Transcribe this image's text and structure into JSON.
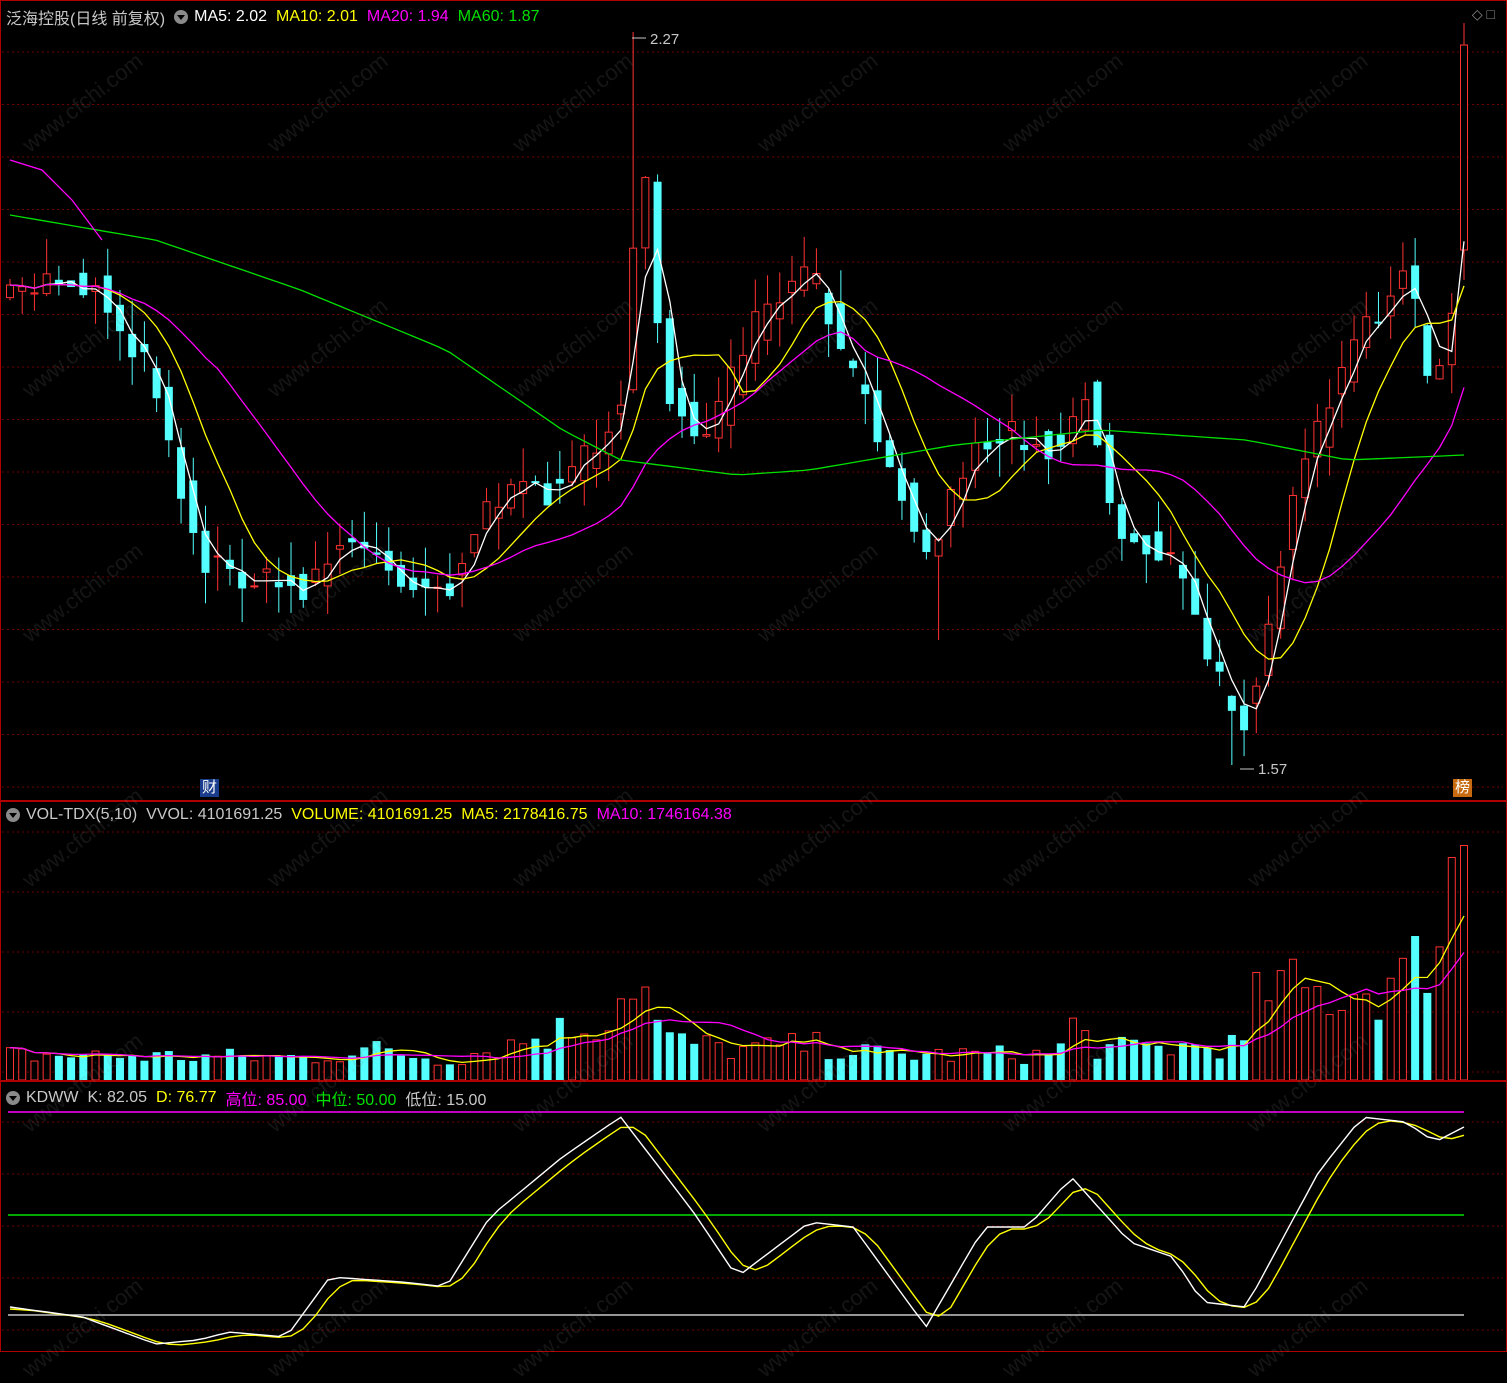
{
  "price_pane": {
    "title": "泛海控股(日线 前复权)",
    "ma5": "MA5: 2.02",
    "ma10": "MA10: 2.01",
    "ma20": "MA20: 1.94",
    "ma60": "MA60: 1.87",
    "high_label": "2.27",
    "low_label": "1.57",
    "fin_badge": "财",
    "rank_badge": "榜",
    "corner_icons": "◇ □"
  },
  "volume_pane": {
    "title": "VOL-TDX(5,10)",
    "vvol": "VVOL: 4101691.25",
    "volume": "VOLUME: 4101691.25",
    "ma5": "MA5: 2178416.75",
    "ma10": "MA10: 1746164.38"
  },
  "kd_pane": {
    "title": "KDWW",
    "k": "K: 82.05",
    "d": "D: 76.77",
    "high": "高位: 85.00",
    "mid": "中位: 50.00",
    "low": "低位: 15.00"
  },
  "watermark": "www.cfchi.com",
  "colors": {
    "up": "#ff3232",
    "down": "#54ffff",
    "ma5": "#ffffff",
    "ma10": "#ffff00",
    "ma20": "#ff00ff",
    "ma60": "#00e000",
    "frame": "#b00000",
    "grid": "#6e0000"
  },
  "chart_data": {
    "type": "candlestick",
    "price_range": [
      1.57,
      2.27
    ],
    "high_price": 2.27,
    "low_price": 1.57,
    "ma_latest": {
      "MA5": 2.02,
      "MA10": 2.01,
      "MA20": 1.94,
      "MA60": 1.87
    },
    "volume_latest": {
      "VOLUME": 4101691.25,
      "MA5": 2178416.75,
      "MA10": 1746164.38
    },
    "kd_latest": {
      "K": 82.05,
      "D": 76.77
    },
    "kd_levels": {
      "high": 85.0,
      "mid": 50.0,
      "low": 15.0
    }
  }
}
